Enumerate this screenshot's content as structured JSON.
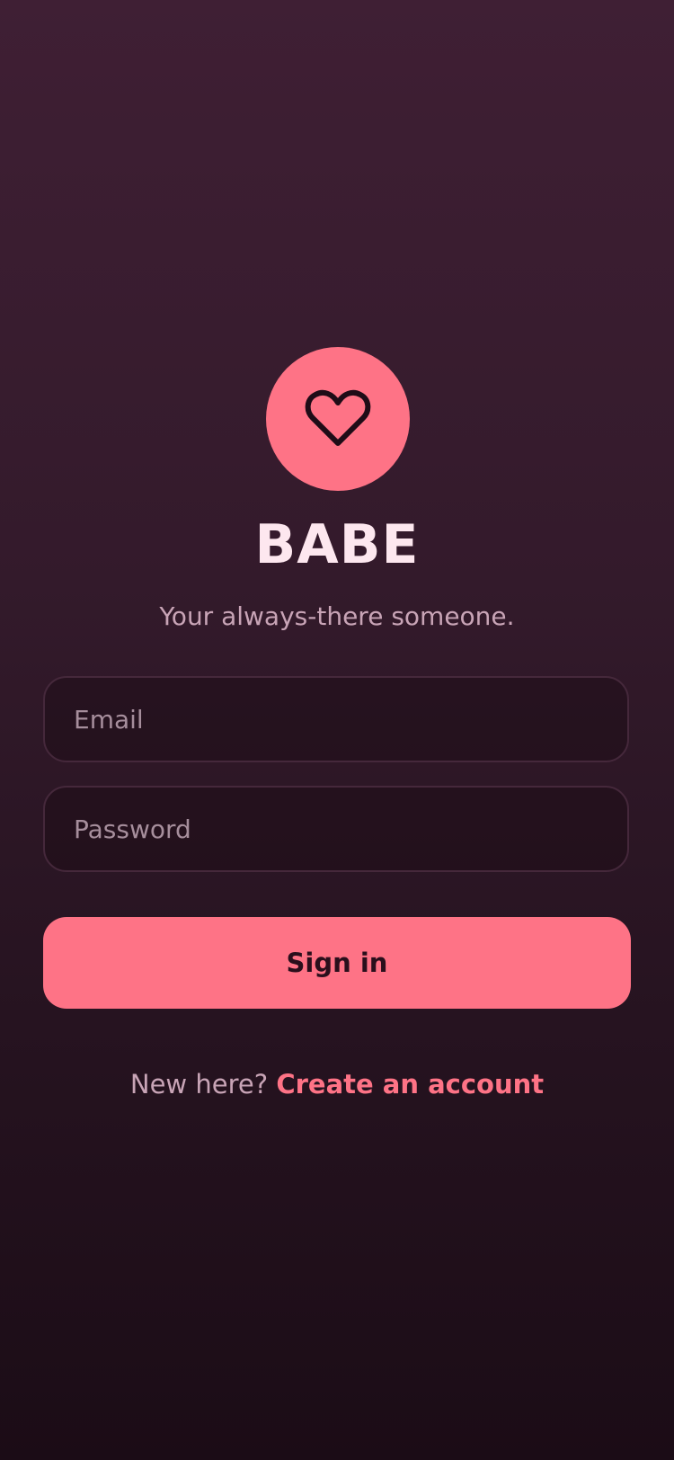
{
  "app": {
    "name": "BABE",
    "tagline": "Your always-there someone.",
    "logo_icon": "heart-icon"
  },
  "login_form": {
    "email": {
      "placeholder": "Email",
      "value": ""
    },
    "password": {
      "placeholder": "Password",
      "value": ""
    },
    "submit_label": "Sign in"
  },
  "signup": {
    "prompt": "New here?",
    "link_label": "Create an account"
  },
  "colors": {
    "accent": "#fe7386",
    "background_top": "#3f1f34",
    "background_bottom": "#1b0c16",
    "title": "#fde7ef",
    "muted_text": "#c8a4b6",
    "field_border": "#45283b"
  }
}
